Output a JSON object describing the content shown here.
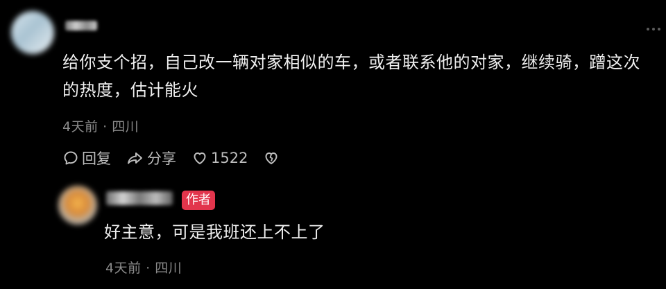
{
  "comment": {
    "text": "给你支个招，自己改一辆对家相似的车，或者联系他的对家，继续骑，蹭这次的热度，估计能火",
    "meta": "4天前 · 四川",
    "actions": {
      "reply_label": "回复",
      "share_label": "分享",
      "like_count": "1522"
    },
    "icons": [
      "comment-bubble-icon",
      "share-arrow-icon",
      "heart-icon",
      "broken-heart-icon",
      "more-dots-icon"
    ]
  },
  "reply": {
    "badge": "作者",
    "text": "好主意，可是我班还上不上了",
    "meta": "4天前 · 四川"
  },
  "colors": {
    "background": "#000000",
    "text": "#efefef",
    "muted": "#8b8b8b",
    "author_badge": "#e2354c"
  }
}
